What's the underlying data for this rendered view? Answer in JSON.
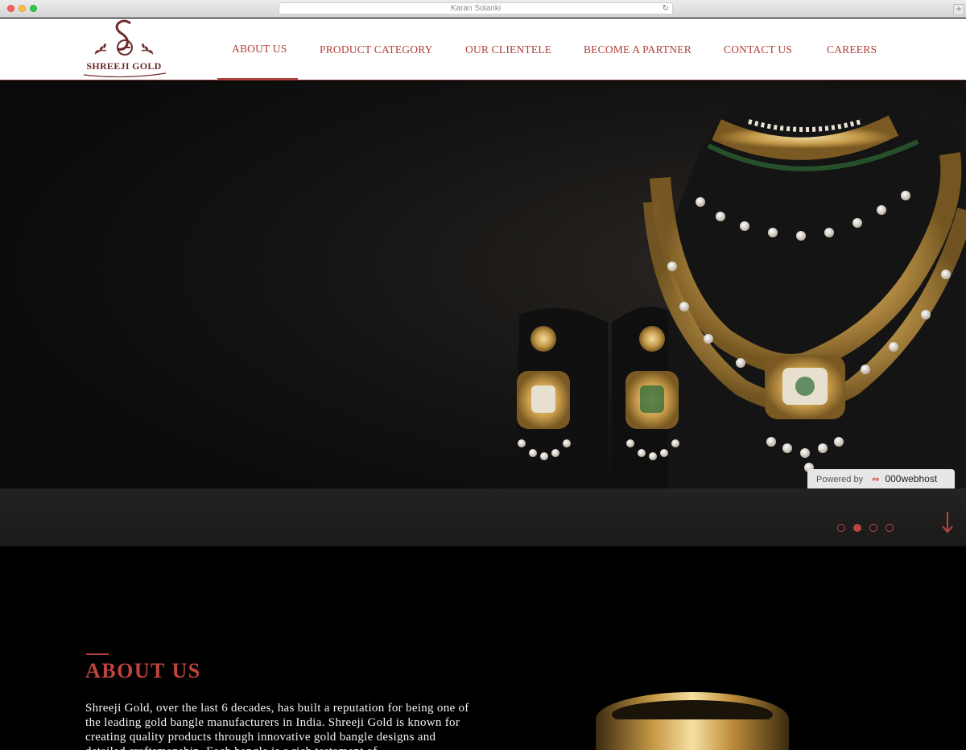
{
  "browser": {
    "window_title": "Karan Solanki"
  },
  "brand": {
    "name": "SHREEJI GOLD",
    "accent": "#b0403a",
    "logo_brown": "#6e2a2a"
  },
  "nav": {
    "items": [
      {
        "label": "ABOUT US",
        "active": true
      },
      {
        "label": "PRODUCT CATEGORY",
        "active": false
      },
      {
        "label": "OUR CLIENTELE",
        "active": false
      },
      {
        "label": "BECOME A PARTNER",
        "active": false
      },
      {
        "label": "CONTACT US",
        "active": false
      },
      {
        "label": "CAREERS",
        "active": false
      }
    ]
  },
  "hero": {
    "slides_count": 4,
    "active_slide": 2,
    "powered_by": {
      "prefix": "Powered by",
      "brand": "000webhost"
    }
  },
  "about": {
    "title": "ABOUT US",
    "text": "Shreeji Gold, over the last 6 decades, has built a reputation for being one of the leading gold bangle manufacturers in India. Shreeji Gold is known for creating quality products through innovative gold bangle designs and detailed craftsmanship. Each bangle is a rich testament of"
  }
}
